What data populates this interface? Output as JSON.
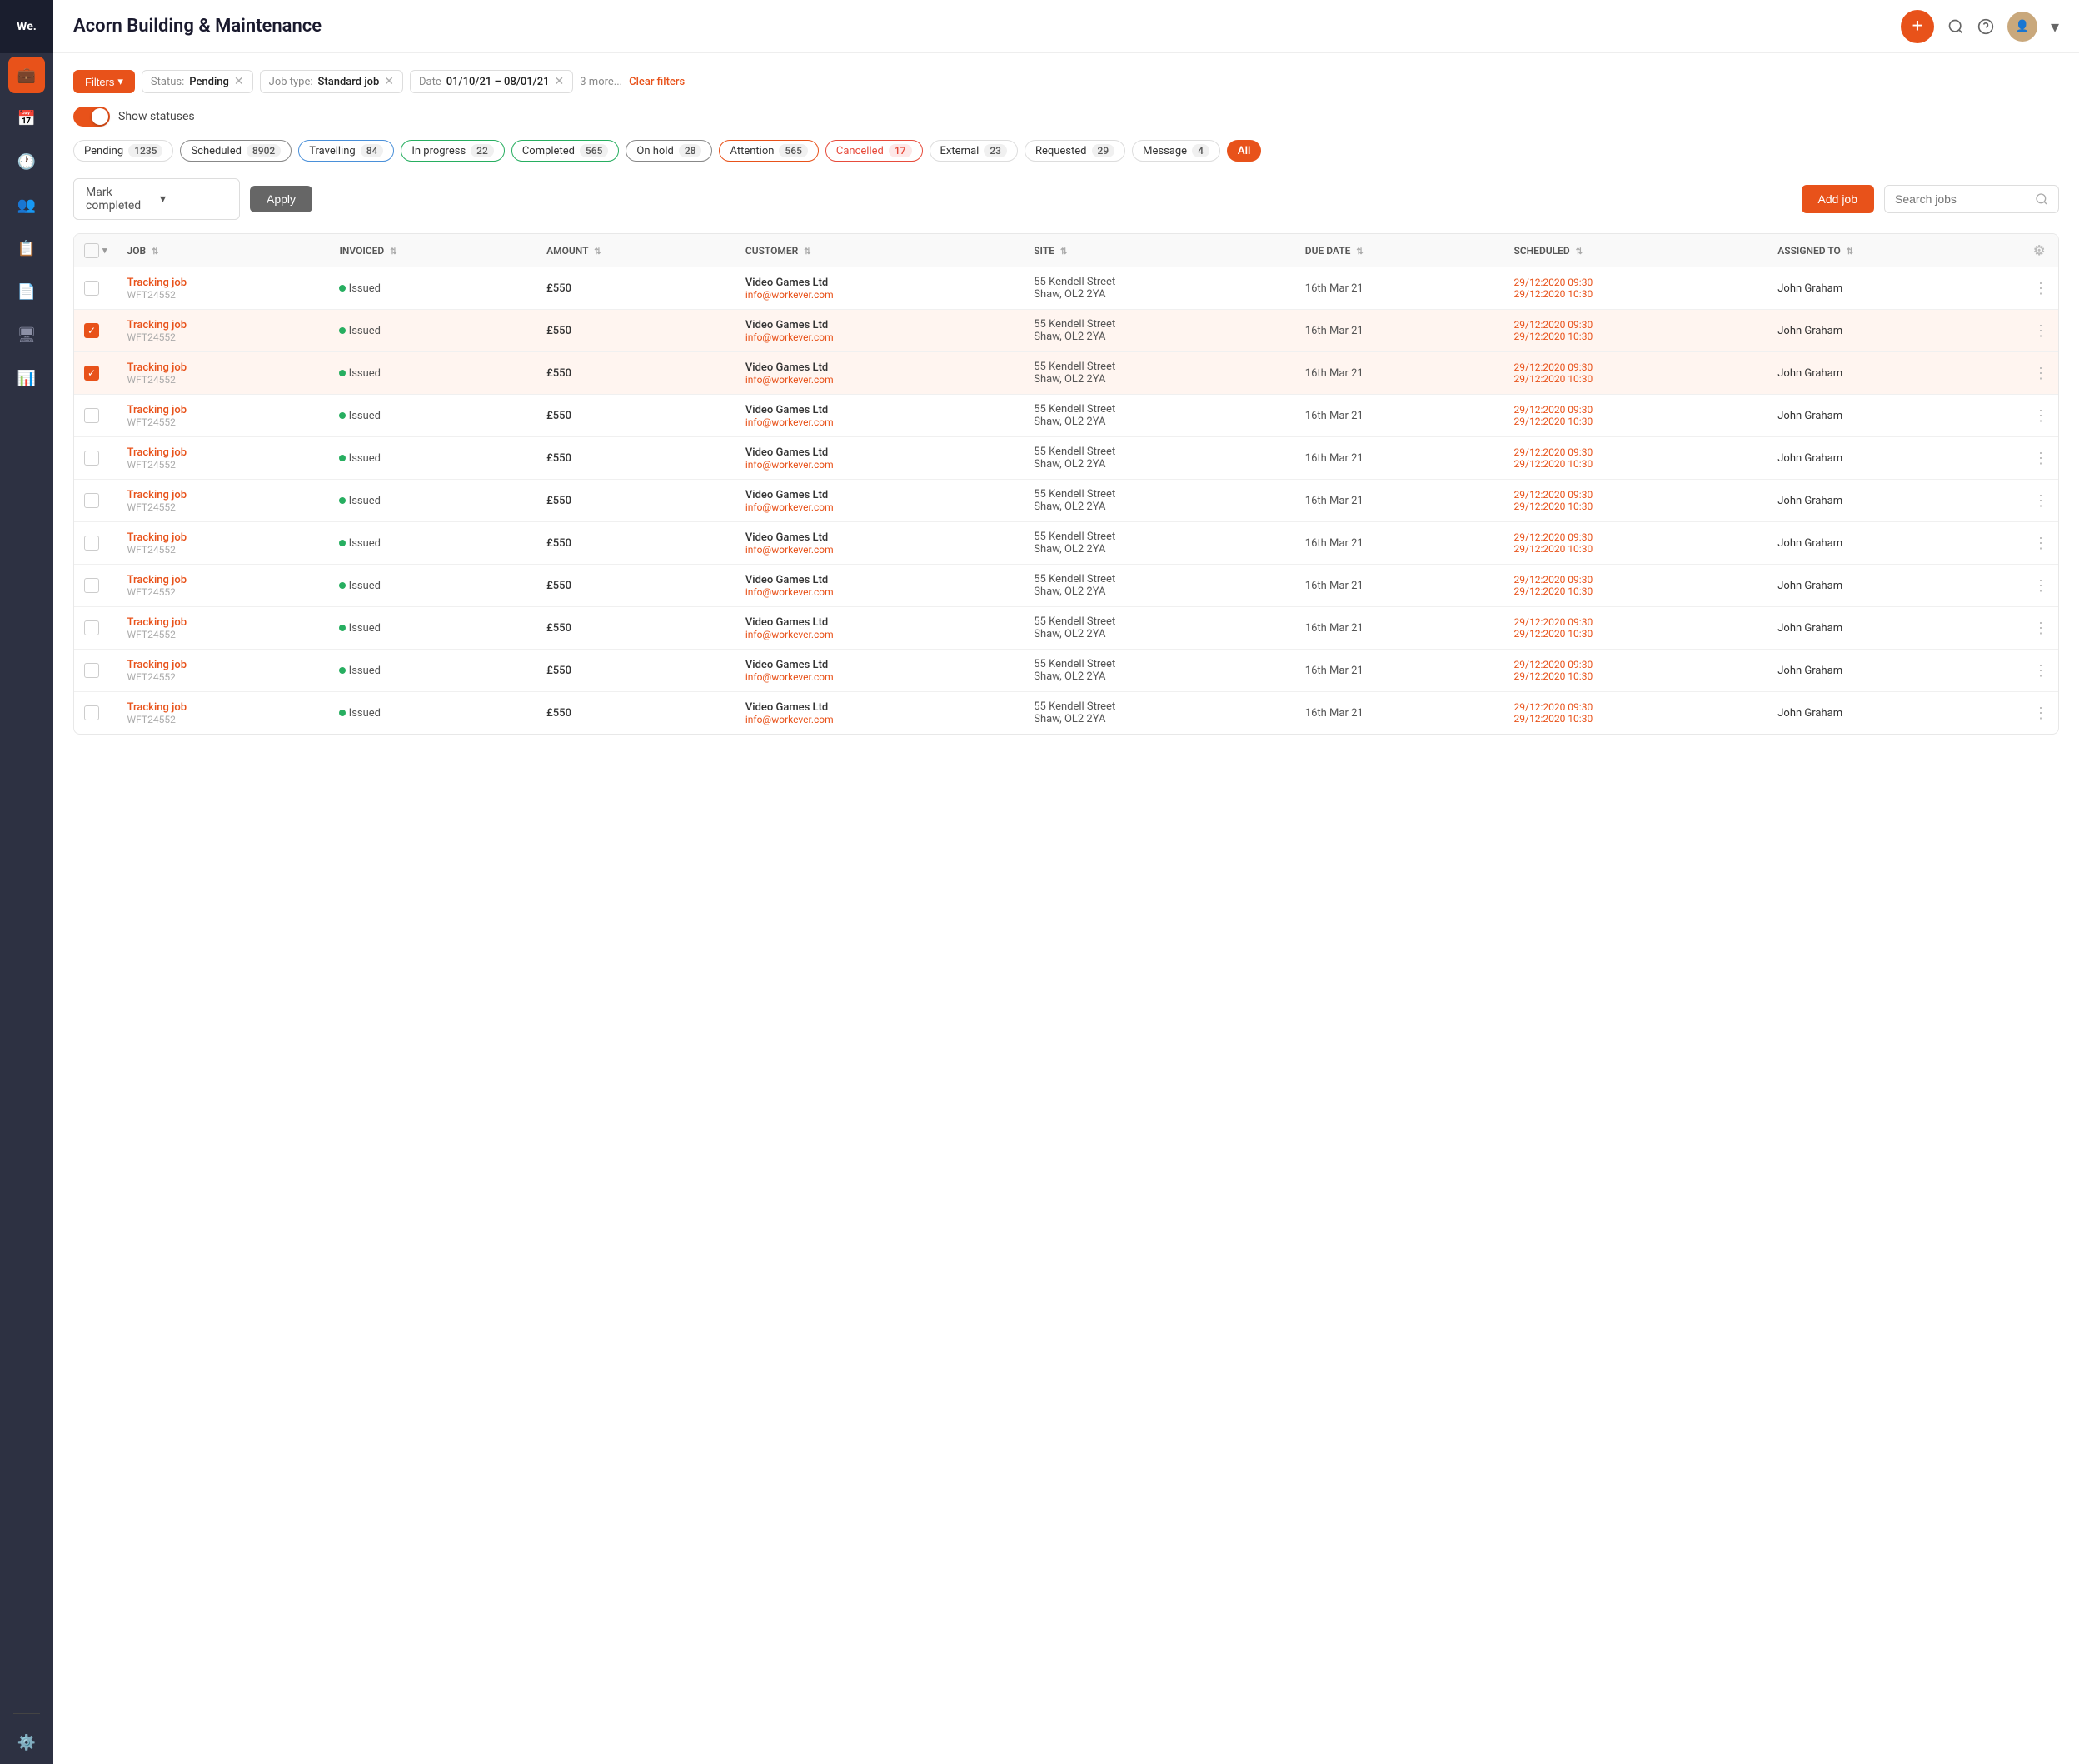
{
  "app": {
    "logo": "We.",
    "title": "Acorn Building & Maintenance"
  },
  "sidebar": {
    "items": [
      {
        "icon": "💼",
        "name": "jobs",
        "label": "Jobs",
        "active": true
      },
      {
        "icon": "📅",
        "name": "schedule",
        "label": "Schedule",
        "active": false
      },
      {
        "icon": "🕐",
        "name": "history",
        "label": "History",
        "active": false
      },
      {
        "icon": "👥",
        "name": "customers",
        "label": "Customers",
        "active": false
      },
      {
        "icon": "📋",
        "name": "quotes",
        "label": "Quotes",
        "active": false
      },
      {
        "icon": "📄",
        "name": "invoices",
        "label": "Invoices",
        "active": false
      },
      {
        "icon": "🖥",
        "name": "dashboard",
        "label": "Dashboard",
        "active": false
      },
      {
        "icon": "📊",
        "name": "reports",
        "label": "Reports",
        "active": false
      }
    ],
    "settings_icon": "⚙️"
  },
  "filters": {
    "button_label": "Filters",
    "tags": [
      {
        "label": "Status:",
        "value": "Pending",
        "id": "status"
      },
      {
        "label": "Job type:",
        "value": "Standard job",
        "id": "job-type"
      },
      {
        "label": "Date",
        "value": "01/10/21 – 08/01/21",
        "id": "date"
      }
    ],
    "more_label": "3 more...",
    "clear_label": "Clear filters"
  },
  "toggle": {
    "label": "Show statuses",
    "checked": true
  },
  "status_chips": [
    {
      "label": "Pending",
      "count": "1235",
      "style": "pending"
    },
    {
      "label": "Scheduled",
      "count": "8902",
      "style": "scheduled"
    },
    {
      "label": "Travelling",
      "count": "84",
      "style": "travelling"
    },
    {
      "label": "In progress",
      "count": "22",
      "style": "in-progress"
    },
    {
      "label": "Completed",
      "count": "565",
      "style": "completed"
    },
    {
      "label": "On hold",
      "count": "28",
      "style": "on-hold"
    },
    {
      "label": "Attention",
      "count": "565",
      "style": "attention"
    },
    {
      "label": "Cancelled",
      "count": "17",
      "style": "cancelled"
    },
    {
      "label": "External",
      "count": "23",
      "style": "external"
    },
    {
      "label": "Requested",
      "count": "29",
      "style": "requested"
    },
    {
      "label": "Message",
      "count": "4",
      "style": "message"
    },
    {
      "label": "All",
      "count": "",
      "style": "all"
    }
  ],
  "toolbar": {
    "action_placeholder": "Mark completed",
    "apply_label": "Apply",
    "add_job_label": "Add job",
    "search_placeholder": "Search jobs"
  },
  "table": {
    "columns": [
      {
        "label": "JOB",
        "id": "job"
      },
      {
        "label": "INVOICED",
        "id": "invoiced"
      },
      {
        "label": "AMOUNT",
        "id": "amount"
      },
      {
        "label": "CUSTOMER",
        "id": "customer"
      },
      {
        "label": "SITE",
        "id": "site"
      },
      {
        "label": "DUE DATE",
        "id": "due_date"
      },
      {
        "label": "SCHEDULED",
        "id": "scheduled"
      },
      {
        "label": "ASSIGNED TO",
        "id": "assigned_to"
      }
    ],
    "rows": [
      {
        "id": 1,
        "job_name": "Tracking job",
        "job_id": "WFT24552",
        "invoiced": "Issued",
        "amount": "£550",
        "customer": "Video Games Ltd",
        "email": "info@workever.com",
        "site": "55  Kendell Street",
        "site2": "Shaw, OL2 2YA",
        "due_date": "16th Mar 21",
        "scheduled1": "29/12:2020 09:30",
        "scheduled2": "29/12:2020 10:30",
        "assigned": "John Graham",
        "checked": false
      },
      {
        "id": 2,
        "job_name": "Tracking job",
        "job_id": "WFT24552",
        "invoiced": "Issued",
        "amount": "£550",
        "customer": "Video Games Ltd",
        "email": "info@workever.com",
        "site": "55  Kendell Street",
        "site2": "Shaw, OL2 2YA",
        "due_date": "16th Mar 21",
        "scheduled1": "29/12:2020 09:30",
        "scheduled2": "29/12:2020 10:30",
        "assigned": "John Graham",
        "checked": true
      },
      {
        "id": 3,
        "job_name": "Tracking job",
        "job_id": "WFT24552",
        "invoiced": "Issued",
        "amount": "£550",
        "customer": "Video Games Ltd",
        "email": "info@workever.com",
        "site": "55  Kendell Street",
        "site2": "Shaw, OL2 2YA",
        "due_date": "16th Mar 21",
        "scheduled1": "29/12:2020 09:30",
        "scheduled2": "29/12:2020 10:30",
        "assigned": "John Graham",
        "checked": true
      },
      {
        "id": 4,
        "job_name": "Tracking job",
        "job_id": "WFT24552",
        "invoiced": "Issued",
        "amount": "£550",
        "customer": "Video Games Ltd",
        "email": "info@workever.com",
        "site": "55  Kendell Street",
        "site2": "Shaw, OL2 2YA",
        "due_date": "16th Mar 21",
        "scheduled1": "29/12:2020 09:30",
        "scheduled2": "29/12:2020 10:30",
        "assigned": "John Graham",
        "checked": false
      },
      {
        "id": 5,
        "job_name": "Tracking job",
        "job_id": "WFT24552",
        "invoiced": "Issued",
        "amount": "£550",
        "customer": "Video Games Ltd",
        "email": "info@workever.com",
        "site": "55  Kendell Street",
        "site2": "Shaw, OL2 2YA",
        "due_date": "16th Mar 21",
        "scheduled1": "29/12:2020 09:30",
        "scheduled2": "29/12:2020 10:30",
        "assigned": "John Graham",
        "checked": false
      },
      {
        "id": 6,
        "job_name": "Tracking job",
        "job_id": "WFT24552",
        "invoiced": "Issued",
        "amount": "£550",
        "customer": "Video Games Ltd",
        "email": "info@workever.com",
        "site": "55  Kendell Street",
        "site2": "Shaw, OL2 2YA",
        "due_date": "16th Mar 21",
        "scheduled1": "29/12:2020 09:30",
        "scheduled2": "29/12:2020 10:30",
        "assigned": "John Graham",
        "checked": false
      },
      {
        "id": 7,
        "job_name": "Tracking job",
        "job_id": "WFT24552",
        "invoiced": "Issued",
        "amount": "£550",
        "customer": "Video Games Ltd",
        "email": "info@workever.com",
        "site": "55  Kendell Street",
        "site2": "Shaw, OL2 2YA",
        "due_date": "16th Mar 21",
        "scheduled1": "29/12:2020 09:30",
        "scheduled2": "29/12:2020 10:30",
        "assigned": "John Graham",
        "checked": false
      },
      {
        "id": 8,
        "job_name": "Tracking job",
        "job_id": "WFT24552",
        "invoiced": "Issued",
        "amount": "£550",
        "customer": "Video Games Ltd",
        "email": "info@workever.com",
        "site": "55  Kendell Street",
        "site2": "Shaw, OL2 2YA",
        "due_date": "16th Mar 21",
        "scheduled1": "29/12:2020 09:30",
        "scheduled2": "29/12:2020 10:30",
        "assigned": "John Graham",
        "checked": false
      },
      {
        "id": 9,
        "job_name": "Tracking job",
        "job_id": "WFT24552",
        "invoiced": "Issued",
        "amount": "£550",
        "customer": "Video Games Ltd",
        "email": "info@workever.com",
        "site": "55  Kendell Street",
        "site2": "Shaw, OL2 2YA",
        "due_date": "16th Mar 21",
        "scheduled1": "29/12:2020 09:30",
        "scheduled2": "29/12:2020 10:30",
        "assigned": "John Graham",
        "checked": false
      },
      {
        "id": 10,
        "job_name": "Tracking job",
        "job_id": "WFT24552",
        "invoiced": "Issued",
        "amount": "£550",
        "customer": "Video Games Ltd",
        "email": "info@workever.com",
        "site": "55  Kendell Street",
        "site2": "Shaw, OL2 2YA",
        "due_date": "16th Mar 21",
        "scheduled1": "29/12:2020 09:30",
        "scheduled2": "29/12:2020 10:30",
        "assigned": "John Graham",
        "checked": false
      },
      {
        "id": 11,
        "job_name": "Tracking job",
        "job_id": "WFT24552",
        "invoiced": "Issued",
        "amount": "£550",
        "customer": "Video Games Ltd",
        "email": "info@workever.com",
        "site": "55  Kendell Street",
        "site2": "Shaw, OL2 2YA",
        "due_date": "16th Mar 21",
        "scheduled1": "29/12:2020 09:30",
        "scheduled2": "29/12:2020 10:30",
        "assigned": "John Graham",
        "checked": false
      }
    ]
  }
}
